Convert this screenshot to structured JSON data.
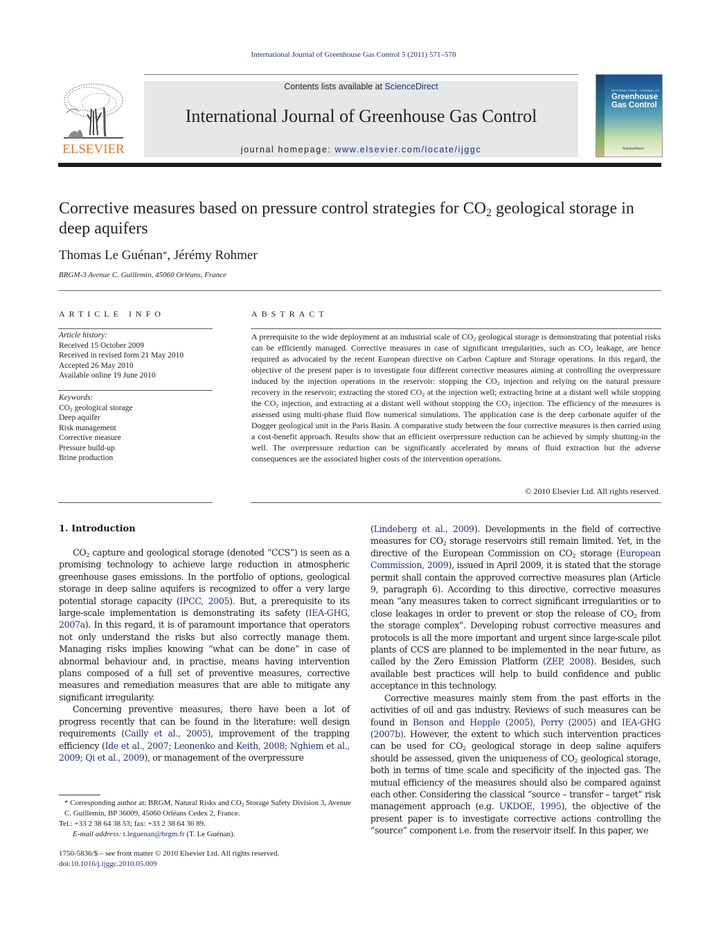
{
  "header": {
    "citation": "International Journal of Greenhouse Gas Control 5 (2011) 571–578",
    "contents_prefix": "Contents lists available at ",
    "contents_link": "ScienceDirect",
    "journal_title": "International Journal of Greenhouse Gas Control",
    "homepage_prefix": "journal homepage: ",
    "homepage_link": "www.elsevier.com/locate/ijggc",
    "publisher_logo_text": "ELSEVIER",
    "cover": {
      "small_line": "INTERNATIONAL JOURNAL OF",
      "title_line1": "Greenhouse",
      "title_line2": "Gas Control",
      "publisher": "ScienceDirect"
    }
  },
  "article": {
    "title_part1": "Corrective measures based on pressure control strategies for CO",
    "title_sub": "2",
    "title_part2": " geological storage in deep aquifers",
    "author1": "Thomas Le Guénan",
    "author_marker": "*",
    "author_sep": ", ",
    "author2": "Jérémy Rohmer",
    "affiliation": "BRGM-3 Avenue C. Guillemin, 45060 Orléans, France"
  },
  "article_info": {
    "heading": "ARTICLE INFO",
    "history_label": "Article history:",
    "history": [
      "Received 15 October 2009",
      "Received in revised form 21 May 2010",
      "Accepted 26 May 2010",
      "Available online 19 June 2010"
    ],
    "keywords_label": "Keywords:",
    "keyword_co2_prefix": "CO",
    "keyword_co2_sub": "2",
    "keyword_co2_suffix": " geological storage",
    "keywords": [
      "Deep aquifer",
      "Risk management",
      "Corrective measure",
      "Pressure build-up",
      "Brine production"
    ]
  },
  "abstract": {
    "heading": "ABSTRACT",
    "segments": [
      "A prerequisite to the wide deployment at an industrial scale of CO",
      " geological storage is demonstrating that potential risks can be efficiently managed. Corrective measures in case of significant irregularities, such as CO",
      " leakage, are hence required as advocated by the recent European directive on Carbon Capture and Storage operations. In this regard, the objective of the present paper is to investigate four different corrective measures aiming at controlling the overpressure induced by the injection operations in the reservoir: stopping the CO",
      " injection and relying on the natural pressure recovery in the reservoir; extracting the stored CO",
      " at the injection well; extracting brine at a distant well while stopping the CO",
      " injection, and extracting at a distant well without stopping the CO",
      " injection. The efficiency of the measures is assessed using multi-phase fluid flow numerical simulations. The application case is the deep carbonate aquifer of the Dogger geological unit in the Paris Basin. A comparative study between the four corrective measures is then carried using a cost-benefit approach. Results show that an efficient overpressure reduction can be achieved by simply shutting-in the well. The overpressure reduction can be significantly accelerated by means of fluid extraction but the adverse consequences are the associated higher costs of the intervention operations."
    ],
    "sub": "2",
    "copyright": "© 2010 Elsevier Ltd. All rights reserved."
  },
  "intro": {
    "heading": "1.  Introduction",
    "left": {
      "p1": [
        "CO",
        " capture and geological storage (denoted “CCS”) is seen as a promising technology to achieve large reduction in atmospheric greenhouse gases emissions. In the portfolio of options, geological storage in deep saline aquifers is recognized to offer a very large potential storage capacity (",
        "IPCC, 2005",
        "). But, a prerequisite to its large-scale implementation is demonstrating its safety (",
        "IEA-GHG, 2007a",
        "). In this regard, it is of paramount importance that operators not only understand the risks but also correctly manage them. Managing risks implies knowing “what can be done” in case of abnormal behaviour and, in practise, means having intervention plans composed of a full set of preventive measures, corrective measures and remediation measures that are able to mitigate any significant irregularity."
      ],
      "p2": [
        "Concerning preventive measures, there have been a lot of progress recently that can be found in the literature: well design requirements (",
        "Cailly et al., 2005",
        "), improvement of the trapping efficiency (",
        "Ide et al., 2007; Leonenko and Keith, 2008; Nghiem et al., 2009; Qi et al., 2009",
        "), or management of the overpressure"
      ]
    },
    "right": {
      "p1": [
        "(",
        "Lindeberg et al., 2009",
        "). Developments in the field of corrective measures for CO",
        " storage reservoirs still remain limited. Yet, in the directive of the European Commission on CO",
        " storage (",
        "European Commission, 2009",
        "), issued in April 2009, it is stated that the storage permit shall contain the approved corrective measures plan (Article 9, paragraph 6). According to this directive, corrective measures mean “any measures taken to correct significant irregularities or to close leakages in order to prevent or stop the release of CO",
        " from the storage complex”. Developing robust corrective measures and protocols is all the more important and urgent since large-scale pilot plants of CCS are planned to be implemented in the near future, as called by the Zero Emission Platform (",
        "ZEP, 2008",
        "). Besides, such available best practices will help to build confidence and public acceptance in this technology."
      ],
      "p2": [
        "Corrective measures mainly stem from the past efforts in the activities of oil and gas industry. Reviews of such measures can be found in ",
        "Benson and Hepple (2005)",
        ", ",
        "Perry (2005)",
        " and ",
        "IEA-GHG (2007b)",
        ". However, the extent to which such intervention practices can be used for CO",
        " geological storage in deep saline aquifers should be assessed, given the uniqueness of CO",
        " geological storage, both in terms of time scale and specificity of the injected gas. The mutual efficiency of the measures should also be compared against each other. Considering the classical “source – transfer – target” risk management approach (e.g. ",
        "UKDOE, 1995",
        "), the objective of the present paper is to investigate corrective actions controlling the “source” component i.e. from the reservoir itself. In this paper, we"
      ]
    },
    "sub": "2"
  },
  "footnote": {
    "line1_prefix": "* Corresponding author at: BRGM, Natural Risks and CO",
    "line1_sub": "2",
    "line1_suffix": " Storage Safety Division 3, Avenue C. Guillemin, BP 36009, 45060 Orléans Cedex 2, France.",
    "line2": "Tel.: +33 2 38 64 38 53; fax: +33 2 38 64 36 89.",
    "email_label": "E-mail address: ",
    "email": "t.leguenan@brgm.fr",
    "email_suffix": " (T. Le Guénan).",
    "front_matter": "1750-5836/$ – see front matter © 2010 Elsevier Ltd. All rights reserved.",
    "doi_prefix": "doi:",
    "doi": "10.1016/j.ijggc.2010.05.009"
  },
  "colors": {
    "link": "#1f2f7a",
    "elsevier_orange": "#e87722",
    "banner_gray": "#e6e7e8"
  }
}
